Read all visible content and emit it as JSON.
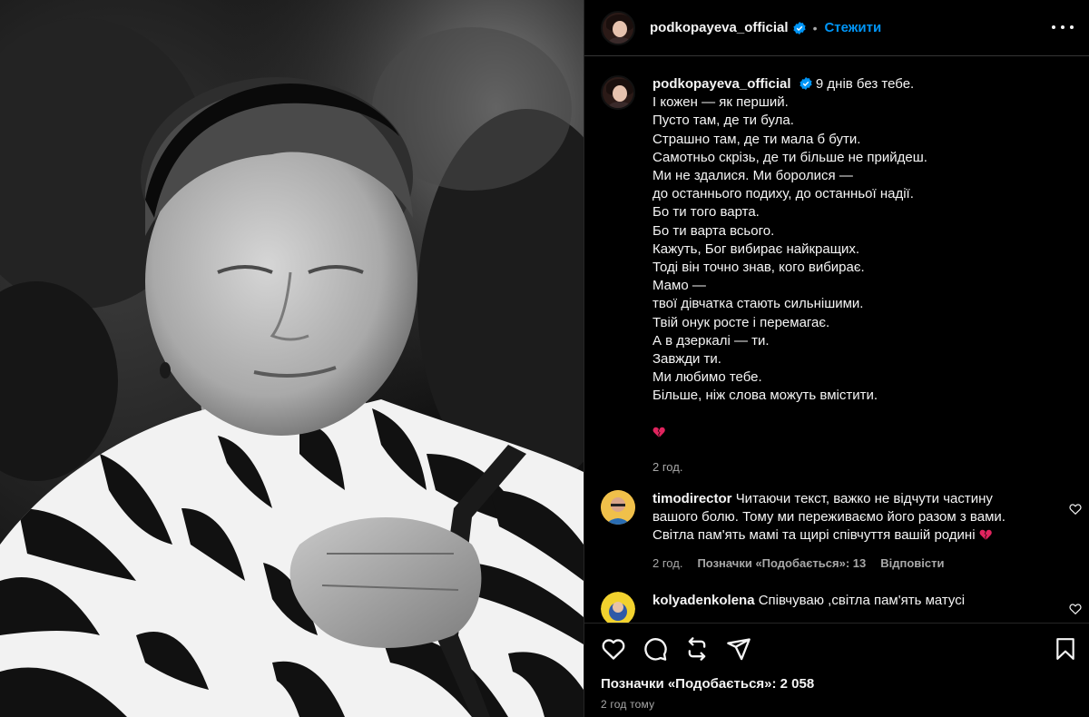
{
  "header": {
    "username": "podkopayeva_official",
    "separator": "•",
    "follow_label": "Стежити"
  },
  "caption": {
    "username": "podkopayeva_official",
    "lines": [
      "9 днів без тебе.",
      "І кожен — як перший.",
      "Пусто там, де ти була.",
      "Страшно там, де ти мала б бути.",
      "Самотньо скрізь, де ти більше не прийдеш.",
      "Ми не здалися. Ми боролися —",
      "до останнього подиху, до останньої надії.",
      "Бо ти того варта.",
      "Бо ти варта всього.",
      "Кажуть, Бог вибирає найкращих.",
      "Тоді він точно знав, кого вибирає.",
      "Мамо —",
      "твої дівчатка стають сильнішими.",
      "Твій онук росте і перемагає.",
      "А в дзеркалі — ти.",
      "Завжди ти.",
      "Ми любимо тебе.",
      "Більше, ніж слова можуть вмістити."
    ],
    "emoji_icon": "broken-heart-emoji",
    "time": "2 год."
  },
  "comments": [
    {
      "username": "timodirector",
      "text_line1": "Читаючи текст, важко не відчути частину",
      "text_line2": "вашого болю. Тому ми переживаємо його разом з вами.",
      "text_line3": "Світла пам'ять мамі та щирі співчуття вашій родині",
      "emoji_icon": "broken-heart-emoji",
      "time": "2 год.",
      "likes": "Позначки «Подобається»: 13",
      "reply": "Відповісти"
    },
    {
      "username": "kolyadenkolena",
      "text": "Співчуваю ,світла пам'ять матусі"
    }
  ],
  "actions": {
    "icons": [
      "heart-icon",
      "comment-icon",
      "repost-icon",
      "share-icon",
      "bookmark-icon"
    ],
    "likes_label": "Позначки «Подобається»: 2 058",
    "posted": "2 год тому"
  },
  "colors": {
    "background": "#000000",
    "accent": "#0095f6",
    "muted": "#a8a8a8",
    "text": "#f5f5f5",
    "heart": "#e0245e"
  }
}
